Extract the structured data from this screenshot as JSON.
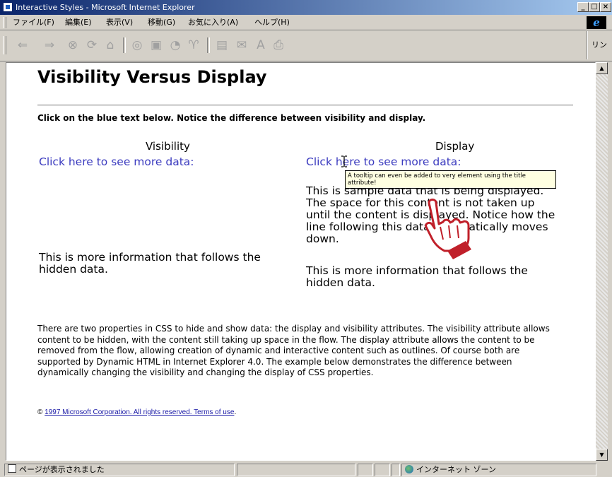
{
  "window": {
    "title": "Interactive Styles - Microsoft Internet Explorer",
    "min_glyph": "_",
    "max_glyph": "□",
    "close_glyph": "×"
  },
  "menu": [
    "ファイル(F)",
    "編集(E)",
    "表示(V)",
    "移動(G)",
    "お気に入り(A)",
    "ヘルプ(H)"
  ],
  "toolbar": {
    "links_label": "リンク",
    "icons": [
      "back-icon",
      "forward-icon",
      "stop-icon",
      "refresh-icon",
      "home-icon",
      "search-icon",
      "favorites-icon",
      "history-icon",
      "channels-icon",
      "fullscreen-icon",
      "mail-icon",
      "font-icon",
      "print-icon"
    ]
  },
  "page": {
    "heading": "Visibility Versus Display",
    "instruction": "Click on the blue text below. Notice the difference between visibility and display.",
    "visibility": {
      "title": "Visibility",
      "link": "Click here to see more data:",
      "after": "This is more information that follows the hidden data."
    },
    "display": {
      "title": "Display",
      "link": "Click here to see more data:",
      "shown": "This is sample data that is being displayed. The space for this content is not taken up until the content is displayed. Notice how the line following this data automatically moves down.",
      "after": "This is more information that follows the hidden data."
    },
    "tooltip": "A tooltip can even be added to very element using the title attribute!",
    "description": "There are two properties in CSS to hide and show data: the display and visibility attributes. The visibility attribute allows content to be hidden, with the content still taking up space in the flow. The display attribute allows the content to be removed from the flow, allowing creation of dynamic and interactive content such as outlines. Of course both are supported by Dynamic HTML in Internet Explorer 4.0. The example below demonstrates the difference between dynamically changing the visibility and changing the display of CSS properties.",
    "copyright_symbol": "©",
    "copyright_link": "1997 Microsoft Corporation. All rights reserved. Terms of use",
    "copyright_end": "."
  },
  "status": {
    "text": "ページが表示されました",
    "zone": "インターネット ゾーン"
  },
  "colors": {
    "link": "#3b3bbf",
    "cursor_hand": "#c0202a",
    "titlebar": "#0a246a"
  }
}
